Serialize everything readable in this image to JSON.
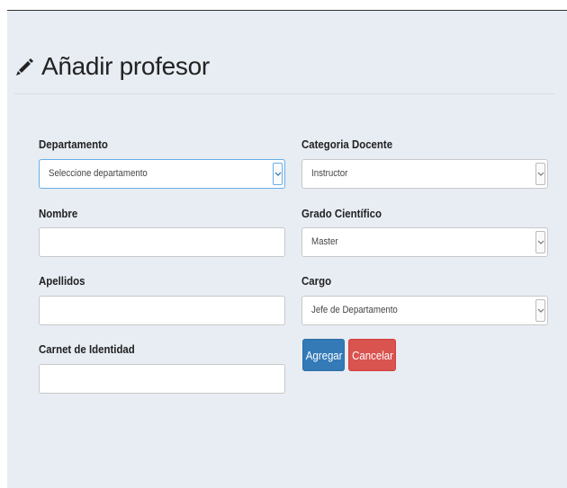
{
  "page": {
    "title": "Añadir profesor"
  },
  "form": {
    "departamento": {
      "label": "Departamento",
      "value": "Seleccione departamento"
    },
    "nombre": {
      "label": "Nombre",
      "value": ""
    },
    "apellidos": {
      "label": "Apellidos",
      "value": ""
    },
    "carnet": {
      "label": "Carnet de Identidad",
      "value": ""
    },
    "categoria": {
      "label": "Categoria Docente",
      "value": "Instructor"
    },
    "grado": {
      "label": "Grado Científico",
      "value": "Master"
    },
    "cargo": {
      "label": "Cargo",
      "value": "Jefe de Departamento"
    }
  },
  "buttons": {
    "agregar": "Agregar",
    "cancelar": "Cancelar"
  },
  "icons": {
    "title_icon": "pencil-icon",
    "select_arrow": "chevron-down-icon"
  },
  "colors": {
    "primary": "#337ab7",
    "danger": "#d9534f",
    "background": "#e8edf4"
  }
}
